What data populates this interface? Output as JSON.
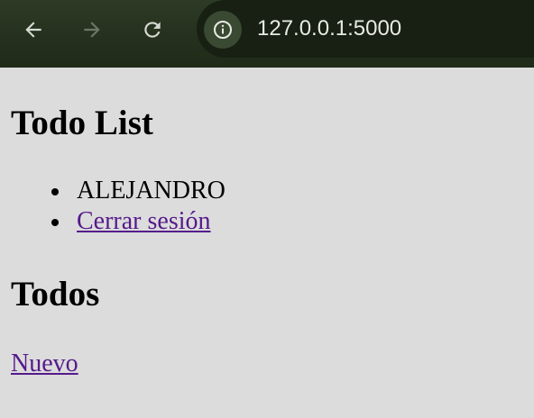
{
  "browser": {
    "url": "127.0.0.1:5000",
    "icons": {
      "back": "back-arrow-icon",
      "forward": "forward-arrow-icon",
      "reload": "reload-icon",
      "site_info": "info-icon"
    }
  },
  "page": {
    "title": "Todo List",
    "nav": [
      {
        "text": "ALEJANDRO"
      },
      {
        "text": "Cerrar sesión"
      }
    ],
    "section_title": "Todos",
    "new_link": "Nuevo"
  },
  "colors": {
    "toolbar": "#2d3a25",
    "page_background": "#dcdcdc",
    "link": "#551a8b"
  }
}
